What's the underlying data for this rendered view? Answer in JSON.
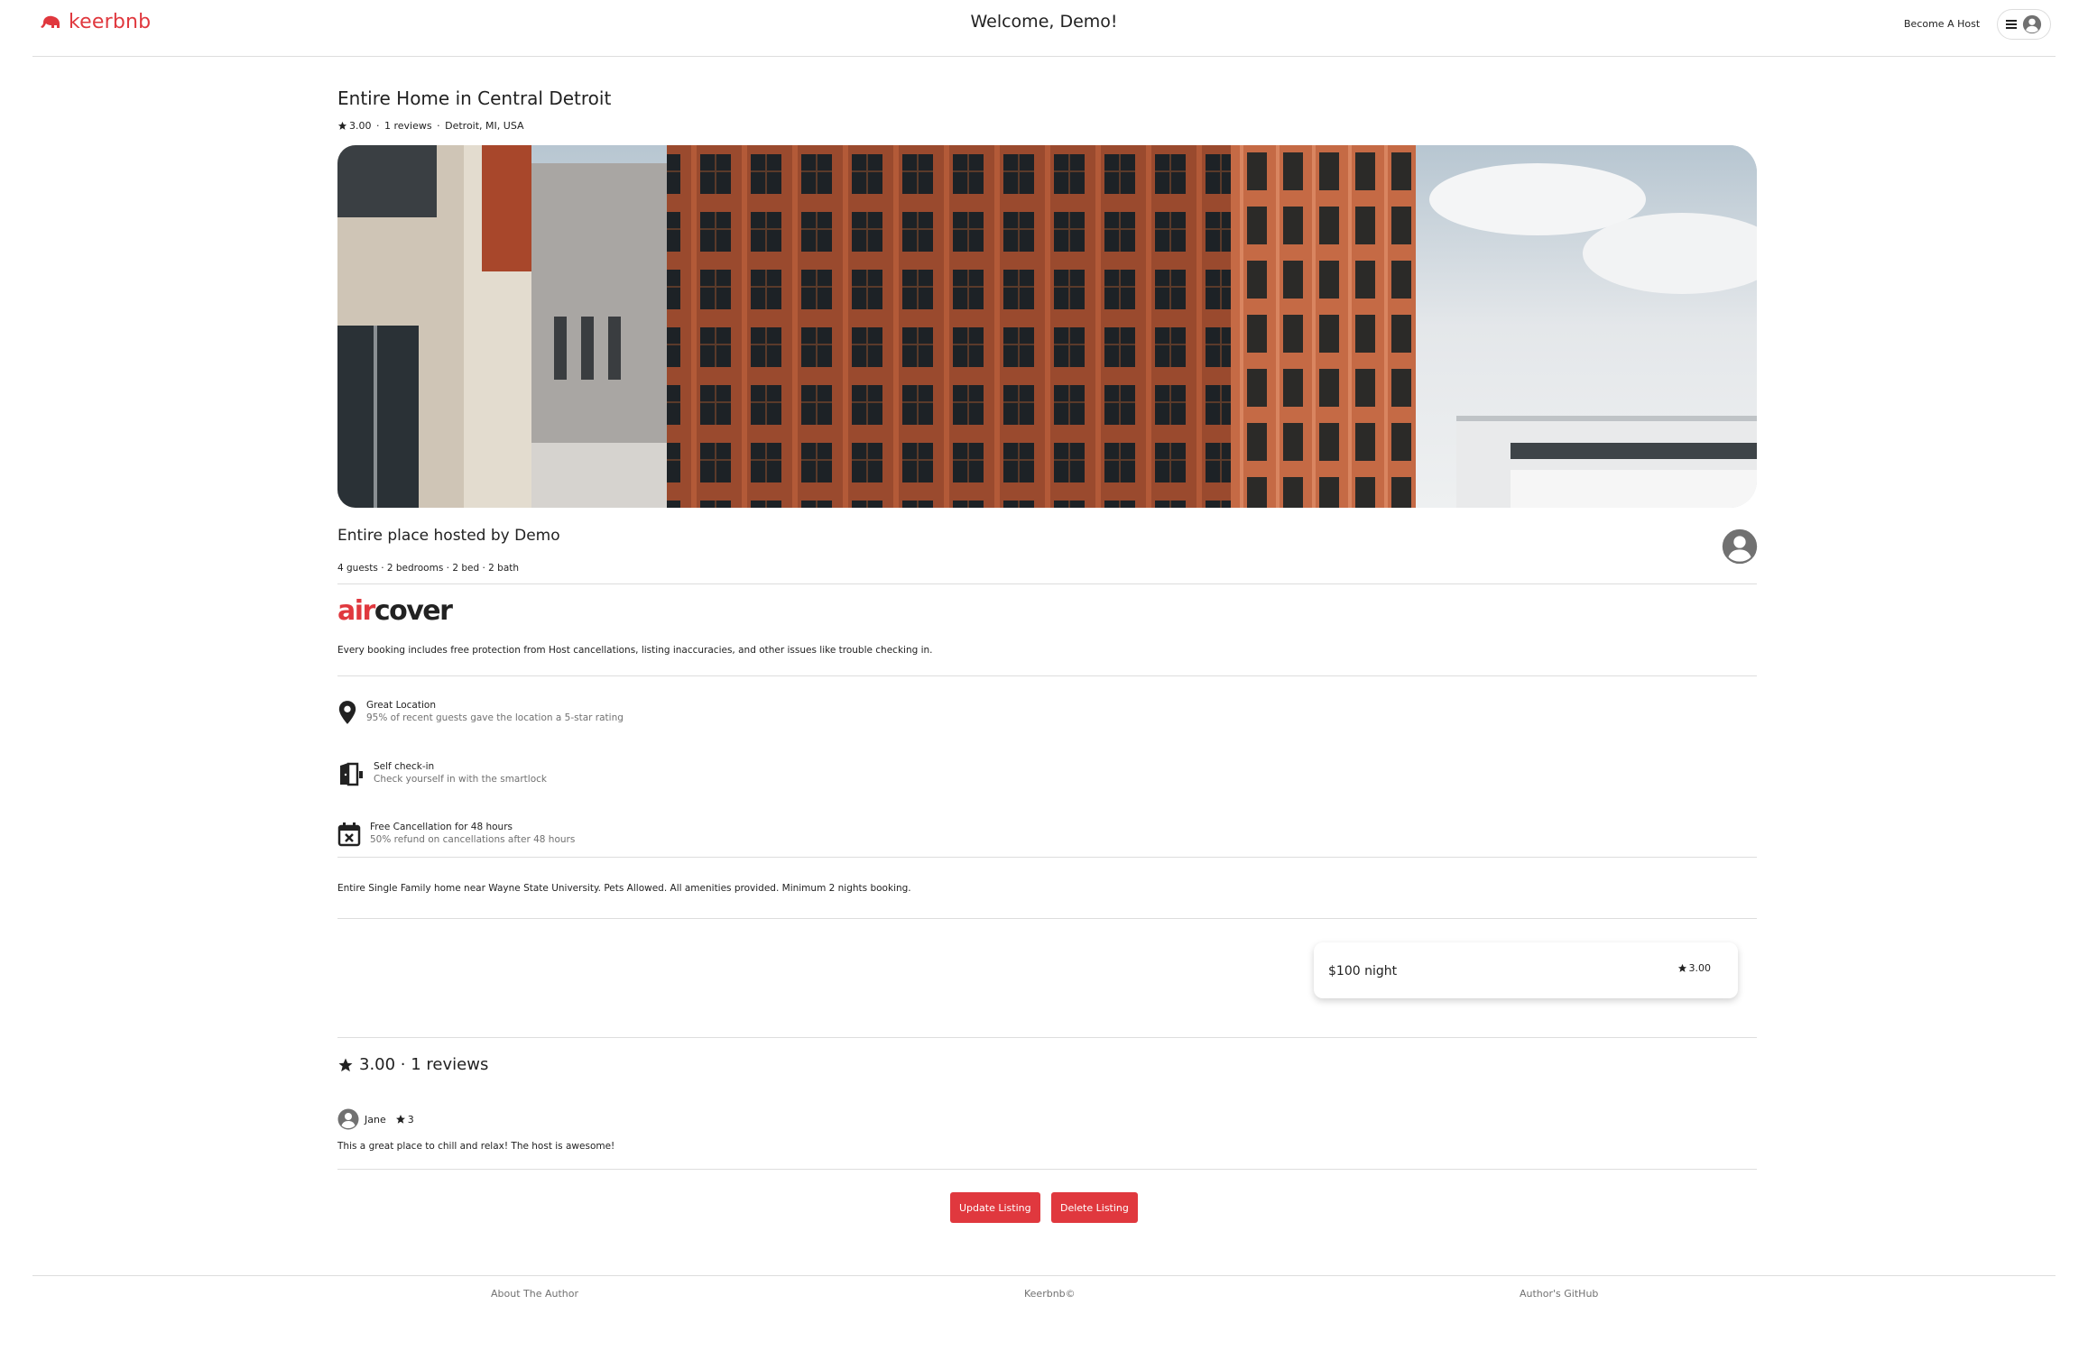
{
  "header": {
    "brand": "keerbnb",
    "welcome": "Welcome, Demo!",
    "become_host": "Become A Host"
  },
  "listing": {
    "title": "Entire Home in Central Detroit",
    "rating": "3.00",
    "reviews_count": "1 reviews",
    "location": "Detroit, MI, USA",
    "hosted_by": "Entire place hosted by Demo",
    "specs": "4 guests · 2 bedrooms · 2 bed · 2 bath",
    "description": "Entire Single Family home near Wayne State University. Pets Allowed. All amenities provided. Minimum 2 nights booking."
  },
  "aircover": {
    "air": "air",
    "cover": "cover",
    "description": "Every booking includes free protection from Host cancellations, listing inaccuracies, and other issues like trouble checking in."
  },
  "features": [
    {
      "icon": "location-pin-icon",
      "title": "Great Location",
      "subtitle": "95% of recent guests gave the location a 5-star rating"
    },
    {
      "icon": "door-icon",
      "title": "Self check-in",
      "subtitle": "Check yourself in with the smartlock"
    },
    {
      "icon": "calendar-x-icon",
      "title": "Free Cancellation for 48 hours",
      "subtitle": "50% refund on cancellations after 48 hours"
    }
  ],
  "booking": {
    "price": "$100 night",
    "rating": "3.00"
  },
  "reviews": {
    "heading": "3.00 · 1 reviews",
    "items": [
      {
        "user": "Jane",
        "stars": "3",
        "text": "This a great place to chill and relax! The host is awesome!"
      }
    ]
  },
  "actions": {
    "update": "Update Listing",
    "delete": "Delete Listing"
  },
  "footer": {
    "about": "About The Author",
    "copyright": "Keerbnb©",
    "github": "Author's GitHub"
  },
  "colors": {
    "accent": "#e0383e",
    "text": "#222222",
    "muted": "#717171",
    "divider": "#dddddd"
  }
}
